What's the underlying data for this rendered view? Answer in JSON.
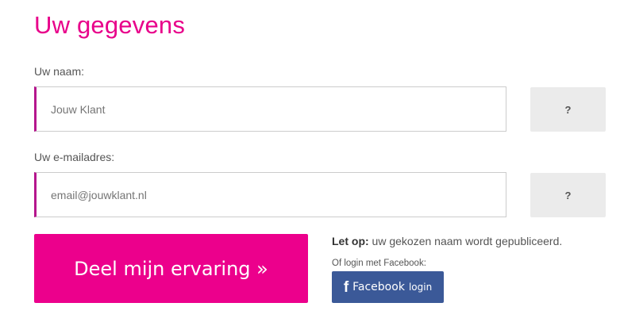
{
  "heading": "Uw gegevens",
  "name_field": {
    "label": "Uw naam:",
    "placeholder": "Jouw Klant",
    "help_label": "?"
  },
  "email_field": {
    "label": "Uw e-mailadres:",
    "placeholder": "email@jouwklant.nl",
    "help_label": "?"
  },
  "submit": {
    "label": "Deel mijn ervaring »"
  },
  "notice": {
    "strong": "Let op:",
    "text": " uw gekozen naam wordt gepubliceerd."
  },
  "facebook": {
    "caption": "Of login met Facebook:",
    "icon": "f",
    "label": "Facebook",
    "sub_label": "login"
  },
  "colors": {
    "accent": "#e8008a",
    "button": "#ec008c",
    "facebook": "#3b5998",
    "help_bg": "#ebebeb"
  }
}
